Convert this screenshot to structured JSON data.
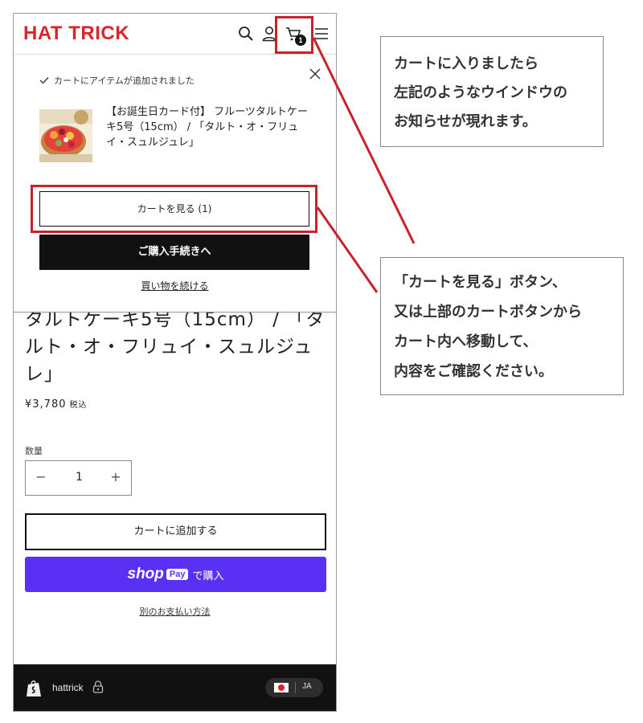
{
  "header": {
    "logo": "HAT TRICK",
    "cart_count": "1"
  },
  "popup": {
    "notice": "カートにアイテムが追加されました",
    "product_name": "【お誕生日カード付】 フルーツタルトケーキ5号（15cm） / 「タルト・オ・フリュイ・スュルジュレ」",
    "view_cart_label": "カートを見る (1)",
    "checkout_label": "ご購入手続きへ",
    "continue_label": "買い物を続ける"
  },
  "product": {
    "title_visible": "タルトケーキ5号（15cm） / 「タルト・オ・フリュイ・スュルジュレ」",
    "price": "¥3,780",
    "tax_label": "税込",
    "quantity_label": "数量",
    "quantity_minus": "−",
    "quantity_value": "1",
    "quantity_plus": "+",
    "add_to_cart_label": "カートに追加する",
    "shop_pay": {
      "shop": "shop",
      "pay": "Pay",
      "buy": "で購入"
    },
    "other_payment_label": "別のお支払い方法"
  },
  "footer": {
    "store_name": "hattrick",
    "language": "JA"
  },
  "annotations": {
    "note1_lines": [
      "カートに入りましたら",
      "左記のようなウインドウの",
      "お知らせが現れます。"
    ],
    "note2_lines": [
      "「カートを見る」ボタン、",
      "又は上部のカートボタンから",
      "カート内へ移動して、",
      "内容をご確認ください。"
    ],
    "accent_color": "#c8232c"
  },
  "colors": {
    "brand_red": "#d7262c",
    "shop_pay_purple": "#5a31f4",
    "footer_bg": "#111111"
  }
}
